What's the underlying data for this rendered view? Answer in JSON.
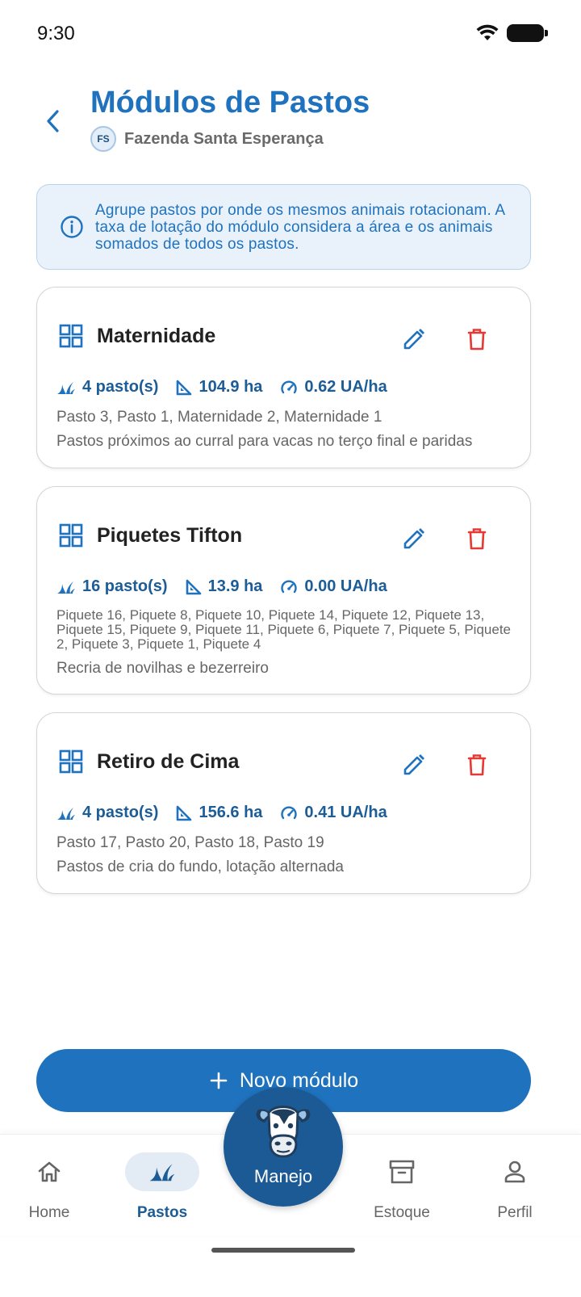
{
  "status": {
    "time": "9:30"
  },
  "header": {
    "title": "Módulos de Pastos",
    "farm_initials": "FS",
    "farm_name": "Fazenda Santa Esperança"
  },
  "info": {
    "text": "Agrupe pastos por onde os mesmos animais rotacionam. A taxa de lotação do módulo considera a área e os animais somados de todos os pastos."
  },
  "modules": [
    {
      "name": "Maternidade",
      "pastures_count": "4 pasto(s)",
      "area": "104.9 ha",
      "rate": "0.62 UA/ha",
      "pastures": "Pasto 3, Pasto 1, Maternidade 2, Maternidade 1",
      "description": "Pastos próximos ao curral para vacas no terço final e paridas"
    },
    {
      "name": "Piquetes Tifton",
      "pastures_count": "16 pasto(s)",
      "area": "13.9 ha",
      "rate": "0.00 UA/ha",
      "pastures": "Piquete 16, Piquete 8, Piquete 10, Piquete 14, Piquete 12, Piquete 13, Piquete 15, Piquete 9, Piquete 11, Piquete 6, Piquete 7, Piquete 5, Piquete 2, Piquete 3, Piquete 1, Piquete 4",
      "description": "Recria de novilhas e bezerreiro"
    },
    {
      "name": "Retiro de Cima",
      "pastures_count": "4 pasto(s)",
      "area": "156.6 ha",
      "rate": "0.41 UA/ha",
      "pastures": "Pasto 17, Pasto 20, Pasto 18, Pasto 19",
      "description": "Pastos de cria do fundo, lotação alternada"
    }
  ],
  "new_button": {
    "label": "Novo módulo"
  },
  "nav": {
    "home": "Home",
    "pastos": "Pastos",
    "manejo": "Manejo",
    "estoque": "Estoque",
    "perfil": "Perfil"
  },
  "colors": {
    "primary": "#1f72bd",
    "primary_dark": "#1c5a96",
    "stat_text": "#1c5c97",
    "delete": "#e53935",
    "info_bg": "#e9f2fa"
  },
  "icons": {
    "back": "chevron-left-icon",
    "module": "grid-icon",
    "edit": "pencil-icon",
    "delete": "trash-icon",
    "pastures": "grass-icon",
    "area": "set-square-icon",
    "rate": "gauge-icon",
    "info": "info-icon"
  }
}
